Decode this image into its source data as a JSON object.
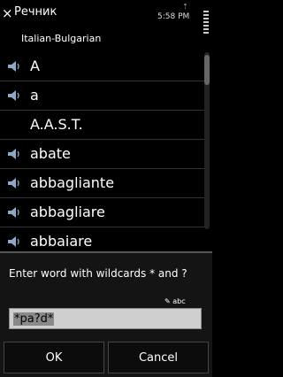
{
  "app": {
    "title": "Речник",
    "subtitle": "Italian-Bulgarian",
    "close_glyph": "×"
  },
  "status": {
    "time": "5:58 PM"
  },
  "list": {
    "items": [
      {
        "word": "A",
        "audio": true
      },
      {
        "word": "a",
        "audio": true
      },
      {
        "word": "A.A.S.T.",
        "audio": false
      },
      {
        "word": "abate",
        "audio": true
      },
      {
        "word": "abbagliante",
        "audio": true
      },
      {
        "word": "abbagliare",
        "audio": true
      },
      {
        "word": "abbaiare",
        "audio": true
      }
    ]
  },
  "dialog": {
    "prompt": "Enter word with wildcards * and ?",
    "input_mode": "abc",
    "input_value": "*pa?d*",
    "ok_label": "OK",
    "cancel_label": "Cancel"
  },
  "icons": {
    "speaker": "speaker-icon",
    "close": "close-icon"
  }
}
